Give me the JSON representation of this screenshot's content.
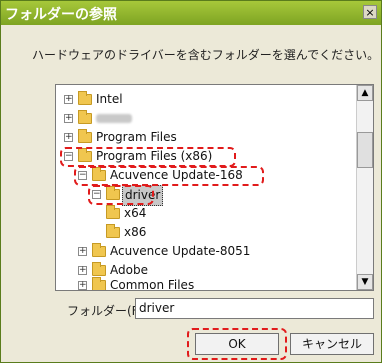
{
  "dialog": {
    "title": "フォルダーの参照",
    "close_glyph": "×",
    "instruction": "ハードウェアのドライバーを含むフォルダーを選んでください。"
  },
  "tree": {
    "items": [
      {
        "label": "Intel",
        "expander": "+"
      },
      {
        "label": "",
        "expander": "+"
      },
      {
        "label": "Program Files",
        "expander": "+"
      },
      {
        "label": "Program Files (x86)",
        "expander": "−"
      },
      {
        "label": "Acuvence Update-168",
        "expander": "−"
      },
      {
        "label": "driver",
        "expander": "−"
      },
      {
        "label": "x64",
        "expander": ""
      },
      {
        "label": "x86",
        "expander": ""
      },
      {
        "label": "Acuvence Update-8051",
        "expander": "+"
      },
      {
        "label": "Adobe",
        "expander": "+"
      },
      {
        "label": "Common Files",
        "expander": "+"
      }
    ],
    "scroll_up": "▲",
    "scroll_down": "▼"
  },
  "folder_field": {
    "label": "フォルダー(F):",
    "value": "driver"
  },
  "buttons": {
    "ok": "OK",
    "cancel": "キャンセル"
  },
  "colors": {
    "titlebar": "#8cb12c",
    "highlight": "#e11b1b"
  }
}
